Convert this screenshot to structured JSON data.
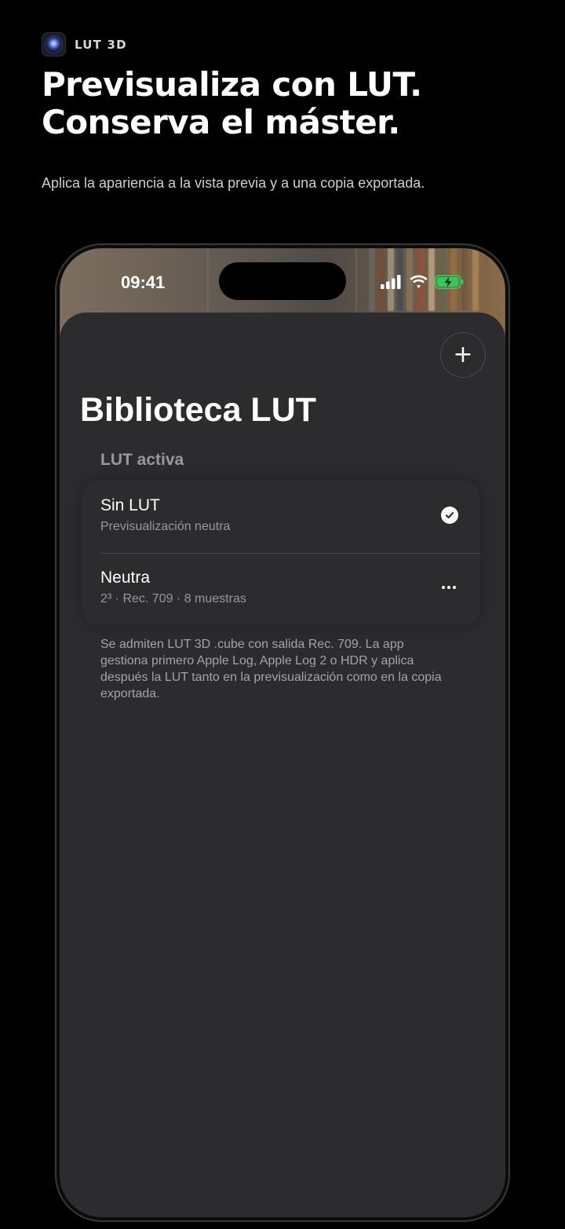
{
  "promo": {
    "badge_label": "LUT 3D",
    "headline_line1": "Previsualiza con LUT.",
    "headline_line2": "Conserva el máster.",
    "subline": "Aplica la apariencia a la vista previa y a una copia exportada."
  },
  "status_bar": {
    "time": "09:41",
    "icons": [
      "cellular-signal-icon",
      "wifi-icon",
      "battery-charging-icon"
    ],
    "battery_color": "#34c759"
  },
  "library": {
    "add_label": "+",
    "title": "Biblioteca LUT",
    "section_header": "LUT activa",
    "items": [
      {
        "title": "Sin LUT",
        "subtitle": "Previsualización neutra",
        "selected": true,
        "accessory": "checkmark-icon"
      },
      {
        "title": "Neutra",
        "subtitle": "2³ · Rec. 709 · 8 muestras",
        "selected": false,
        "accessory": "more-icon"
      }
    ],
    "footnote": "Se admiten LUT 3D .cube con salida Rec. 709. La app gestiona primero Apple Log, Apple Log 2 o HDR y aplica después la LUT tanto en la previsualización como en la copia exportada."
  },
  "colors": {
    "background": "#000000",
    "sheet": "#2c2c2e",
    "secondary_text": "#98989d"
  }
}
